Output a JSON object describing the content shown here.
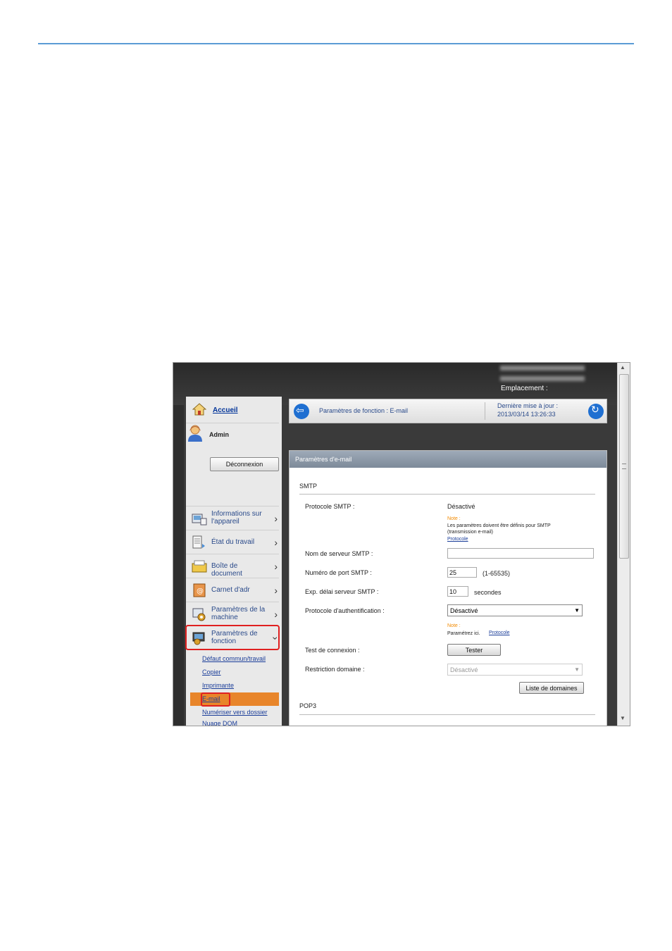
{
  "header_info": {
    "location_label": "Emplacement :"
  },
  "sidebar": {
    "home_label": "Accueil",
    "user_name": "Admin",
    "logout_label": "Déconnexion",
    "menu": [
      {
        "line1": "Informations sur",
        "line2": "l'appareil"
      },
      {
        "line1": "État du travail",
        "line2": ""
      },
      {
        "line1": "Boîte de document",
        "line2": ""
      },
      {
        "line1": "Carnet d'adr",
        "line2": ""
      },
      {
        "line1": "Paramètres de la",
        "line2": "machine"
      },
      {
        "line1": "Paramètres de",
        "line2": "fonction"
      }
    ],
    "submenu": [
      "Défaut commun/travail",
      "Copier",
      "Imprimante",
      "E-mail",
      "Numériser vers dossier",
      "Nuage DOM"
    ]
  },
  "toolbar": {
    "title": "Paramètres de fonction : E-mail",
    "last_update_label": "Dernière mise à jour :",
    "last_update_value": "2013/03/14 13:26:33"
  },
  "panel": {
    "title": "Paramètres d'e-mail",
    "section_smtp": "SMTP",
    "smtp_protocol_label": "Protocole SMTP :",
    "smtp_protocol_value": "Désactivé",
    "note_label": "Note :",
    "note1_text": "Les paramètres doivent être définis pour SMTP (transmission e-mail)",
    "note1_link": "Protocole",
    "server_name_label": "Nom de serveur SMTP :",
    "server_name_value": "",
    "port_label": "Numéro de port SMTP :",
    "port_value": "25",
    "port_range": "(1-65535)",
    "timeout_label": "Exp. délai serveur SMTP :",
    "timeout_value": "10",
    "timeout_unit": "secondes",
    "auth_label": "Protocole d'authentification :",
    "auth_value": "Désactivé",
    "note2_label": "Note :",
    "note2_text": "Paramétrez ici.",
    "note2_link": "Protocole",
    "test_label": "Test de connexion :",
    "test_button": "Tester",
    "domain_label": "Restriction domaine :",
    "domain_value": "Désactivé",
    "domain_list_button": "Liste de domaines",
    "section_pop3": "POP3"
  }
}
